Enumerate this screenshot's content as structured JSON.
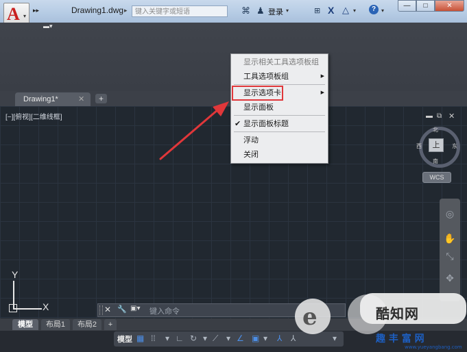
{
  "window": {
    "title": "Drawing1.dwg",
    "search_placeholder": "键入关键字或短语",
    "login_label": "登录",
    "min_label": "—",
    "max_label": "□",
    "close_label": "✕",
    "app_logo": "A"
  },
  "file_tabs": {
    "active": "Drawing1*",
    "add_label": "+"
  },
  "viewport": {
    "label": "[−][俯视][二维线框]"
  },
  "viewcube": {
    "face": "上",
    "north": "北",
    "south": "南",
    "east": "东",
    "west": "西",
    "wcs": "WCS"
  },
  "ucs": {
    "x": "X",
    "y": "Y"
  },
  "context_menu": {
    "items": [
      {
        "label": "显示相关工具选项板组",
        "disabled": true
      },
      {
        "label": "工具选项板组",
        "submenu": true
      },
      {
        "label": "显示选项卡",
        "submenu": true,
        "highlighted": true
      },
      {
        "label": "显示面板"
      },
      {
        "label": "显示面板标题",
        "checked": true
      },
      {
        "label": "浮动"
      },
      {
        "label": "关闭"
      }
    ],
    "check_glyph": "✔",
    "arrow_glyph": "▶"
  },
  "command_line": {
    "placeholder": "键入命令"
  },
  "layout_tabs": [
    "模型",
    "布局1",
    "布局2"
  ],
  "layout_add": "+",
  "status_bar": {
    "model_label": "模型"
  },
  "watermark": {
    "brand": "酷知网",
    "sub": "趣 丰 富 网",
    "url": "www.yueyangbang.com"
  },
  "colors": {
    "accent_red": "#e0373a",
    "canvas_bg": "#212830"
  }
}
